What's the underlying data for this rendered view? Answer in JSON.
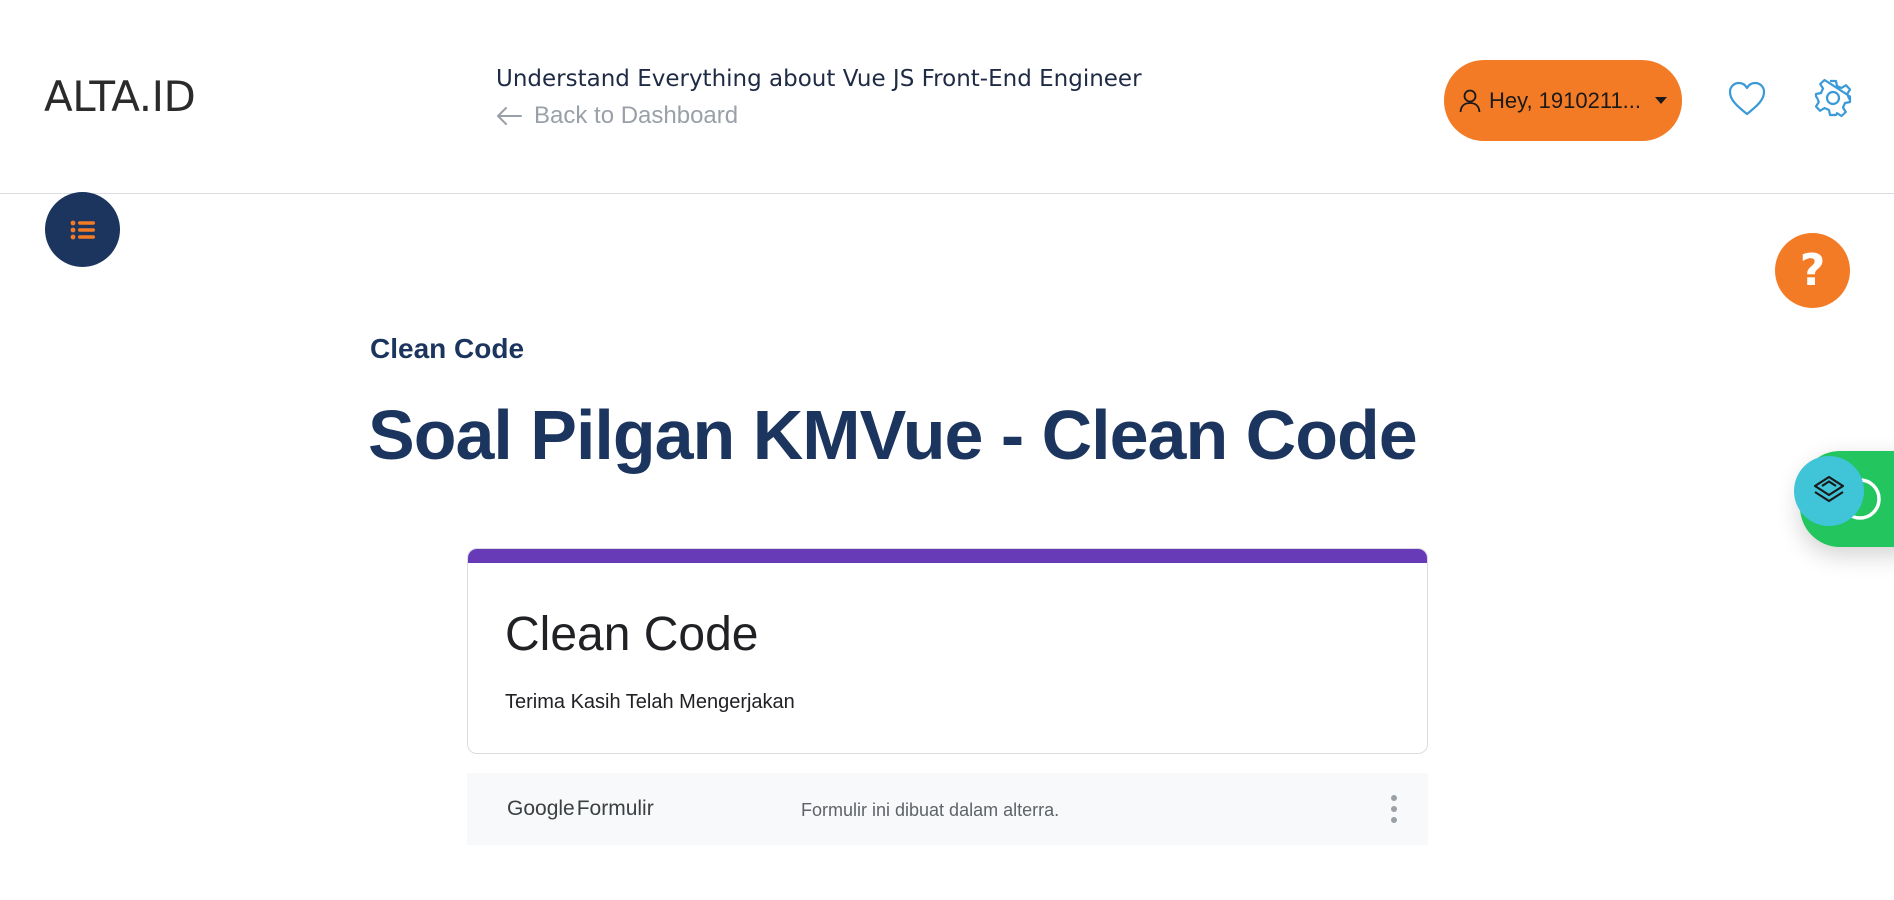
{
  "header": {
    "logo": "ALTA.ID",
    "course_title": "Understand Everything about Vue JS Front-End Engineer",
    "back_label": "Back to Dashboard",
    "user_greeting": "Hey, 1910211...",
    "icons": [
      "user-icon",
      "caret-down-icon",
      "heart-icon",
      "gear-icon",
      "arrow-left-icon"
    ]
  },
  "fabs": {
    "menu_icon": "list-icon",
    "help_label": "?",
    "whatsapp_icon": "whatsapp-icon",
    "chat_icon": "chat-widget-icon"
  },
  "main": {
    "section_label": "Clean Code",
    "heading": "Soal Pilgan KMVue - Clean Code"
  },
  "form": {
    "title": "Clean Code",
    "message": "Terima Kasih Telah Mengerjakan",
    "accent_color": "#673ab7"
  },
  "footer": {
    "brand_google": "Google",
    "brand_formulir": "Formulir",
    "note": "Formulir ini dibuat dalam alterra."
  },
  "colors": {
    "brand_orange": "#f47b25",
    "navy": "#1c355e",
    "whatsapp_green": "#22c55e",
    "chat_teal": "#3fc4d8"
  }
}
